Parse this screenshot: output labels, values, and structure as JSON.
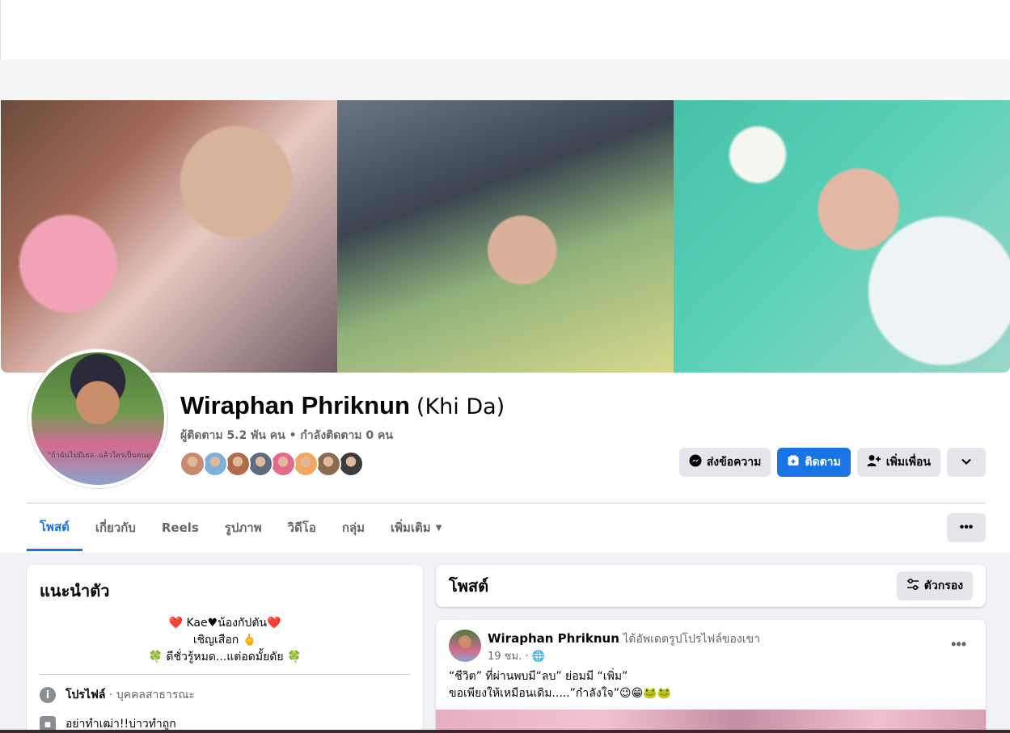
{
  "profile": {
    "name": "Wiraphan Phriknun",
    "alt_name": "(Khi Da)",
    "stats": "ผู้ติดตาม 5.2 พัน คน • กำลังติดตาม 0 คน",
    "picture_caption": "\"ถ้าฉันไม่มีเธอ..แล้วใครเป็นคนดูแลฉัน\""
  },
  "friend_avatars": [
    "#c88b6e",
    "#7fb0d8",
    "#b06a4c",
    "#5d6b80",
    "#e06b8a",
    "#f0a860",
    "#8a6a50",
    "#3c3c3c"
  ],
  "actions": {
    "message": "ส่งข้อความ",
    "follow": "ติดตาม",
    "add_friend": "เพิ่มเพื่อน"
  },
  "tabs": [
    "โพสต์",
    "เกี่ยวกับ",
    "Reels",
    "รูปภาพ",
    "วิดีโอ",
    "กลุ่ม",
    "เพิ่มเติม"
  ],
  "intro": {
    "title": "แนะนำตัว",
    "bio": [
      "❤️ Kae♥น้องกัปตัน❤️",
      "เชิญเสือก 🖕",
      "🍀 ดีชั่วรู้หมด...แต่อดมั้ยดัย 🍀"
    ],
    "profile_label": "โปรไฟล์",
    "profile_type": " · บุคคลสาธารณะ",
    "work": "อย่าทำเฒ่า!!บ่าวทำถูก"
  },
  "posts": {
    "title": "โพสต์",
    "filter": "ตัวกรอง"
  },
  "post": {
    "author": "Wiraphan Phriknun",
    "action": " ได้อัพเดตรูปโปรไฟล์ของเขา",
    "time": "19 ชม. · 🌐",
    "line1": "“ชีวิต” ที่ผ่านพบมี“ลบ” ย่อมมี “เพิ่ม”",
    "line2": "ขอเพียงให้เหมือนเดิม.....”กำลังใจ”😉😁🐸🐸"
  },
  "colors": {
    "accent": "#1b74e4",
    "secondary_button": "#e4e6eb",
    "feed_background": "#f0f2f5"
  }
}
